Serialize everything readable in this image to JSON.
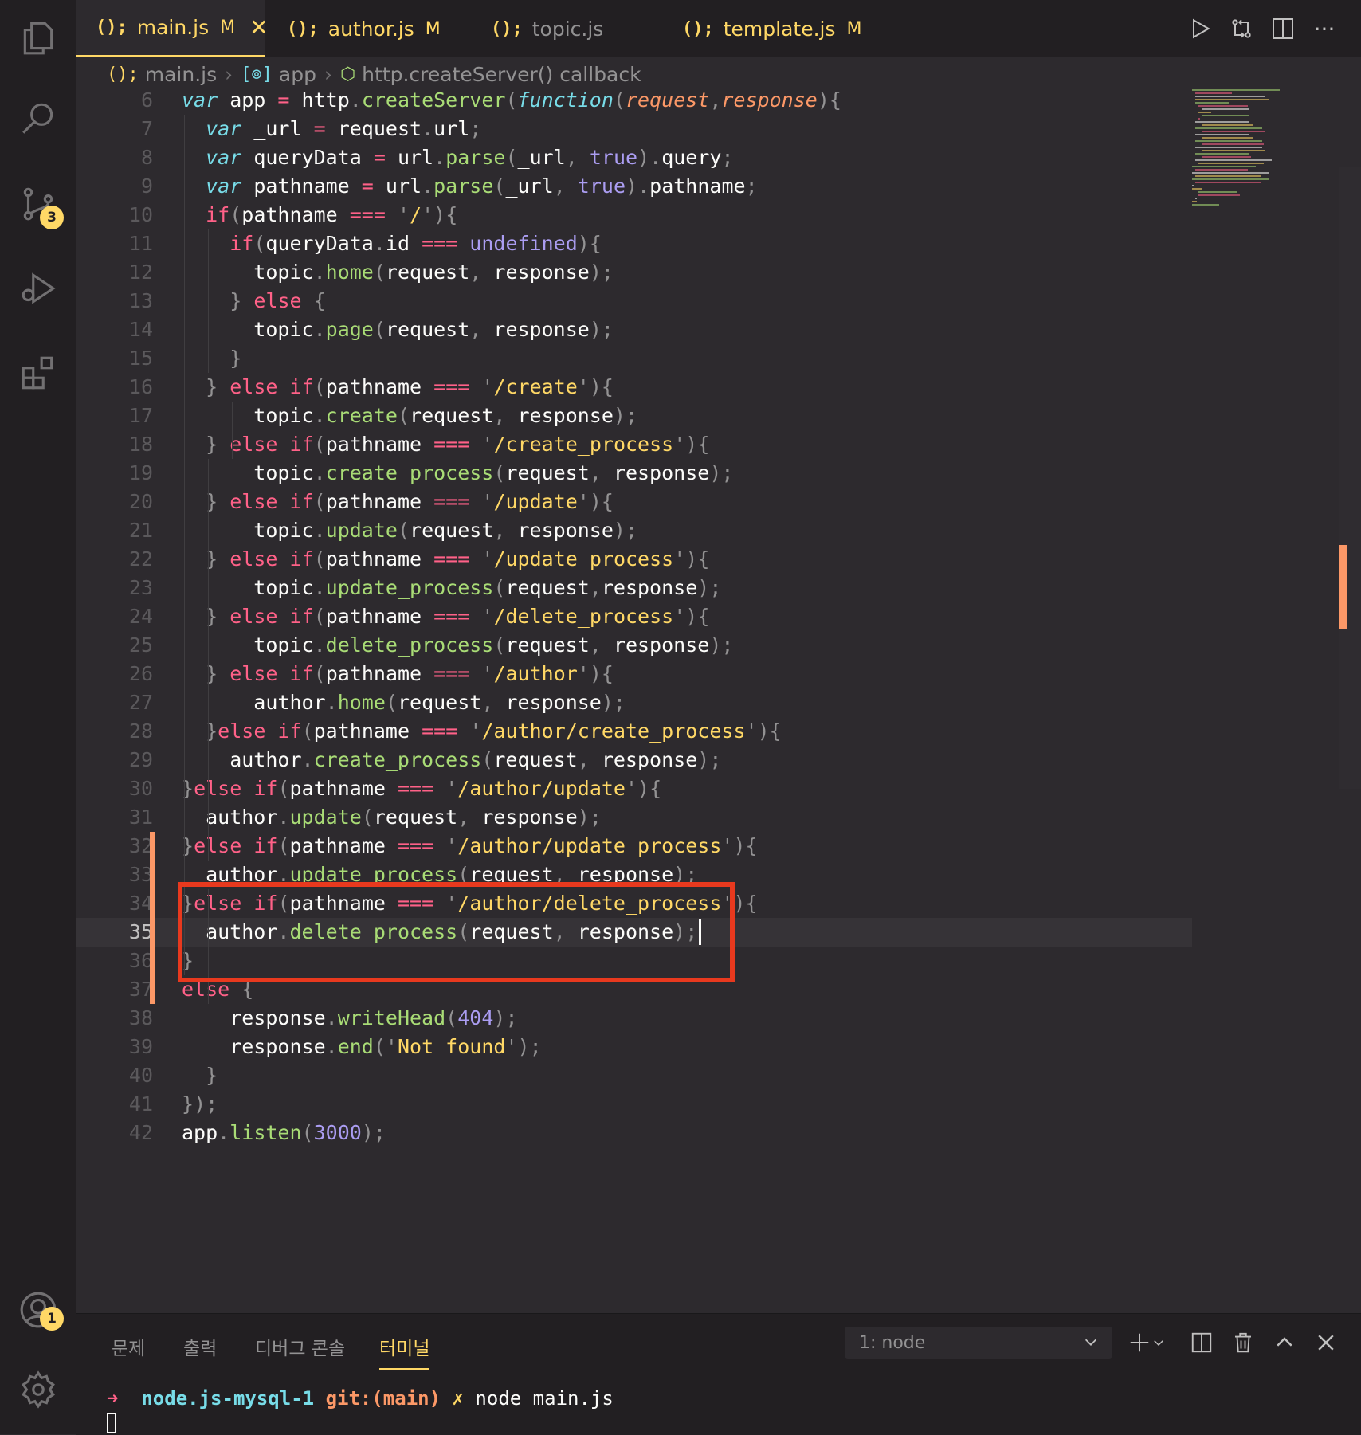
{
  "tabs": [
    {
      "icon": "(); ",
      "label": "main.js",
      "modified": "M",
      "active": true
    },
    {
      "icon": "(); ",
      "label": "author.js",
      "modified": "M",
      "active": false
    },
    {
      "icon": "(); ",
      "label": "topic.js",
      "modified": "",
      "active": false
    },
    {
      "icon": "(); ",
      "label": "template.js",
      "modified": "M",
      "active": false
    }
  ],
  "breadcrumb": {
    "file": "main.js",
    "symbol1": "app",
    "symbol2": "http.createServer() callback"
  },
  "badges": {
    "scm": "3",
    "accounts": "1"
  },
  "code": {
    "lines": [
      {
        "n": "6",
        "t": "var app = http.createServer(function(request,response){"
      },
      {
        "n": "7",
        "t": "  var _url = request.url;"
      },
      {
        "n": "8",
        "t": "  var queryData = url.parse(_url, true).query;"
      },
      {
        "n": "9",
        "t": "  var pathname = url.parse(_url, true).pathname;"
      },
      {
        "n": "10",
        "t": "  if(pathname === '/'){"
      },
      {
        "n": "11",
        "t": "    if(queryData.id === undefined){"
      },
      {
        "n": "12",
        "t": "      topic.home(request, response);"
      },
      {
        "n": "13",
        "t": "    } else {"
      },
      {
        "n": "14",
        "t": "      topic.page(request, response);"
      },
      {
        "n": "15",
        "t": "    }"
      },
      {
        "n": "16",
        "t": "  } else if(pathname === '/create'){"
      },
      {
        "n": "17",
        "t": "      topic.create(request, response);"
      },
      {
        "n": "18",
        "t": "  } else if(pathname === '/create_process'){"
      },
      {
        "n": "19",
        "t": "      topic.create_process(request, response);"
      },
      {
        "n": "20",
        "t": "  } else if(pathname === '/update'){"
      },
      {
        "n": "21",
        "t": "      topic.update(request, response);"
      },
      {
        "n": "22",
        "t": "  } else if(pathname === '/update_process'){"
      },
      {
        "n": "23",
        "t": "      topic.update_process(request,response);"
      },
      {
        "n": "24",
        "t": "  } else if(pathname === '/delete_process'){"
      },
      {
        "n": "25",
        "t": "      topic.delete_process(request, response);"
      },
      {
        "n": "26",
        "t": "  } else if(pathname === '/author'){"
      },
      {
        "n": "27",
        "t": "      author.home(request, response);"
      },
      {
        "n": "28",
        "t": "  }else if(pathname === '/author/create_process'){"
      },
      {
        "n": "29",
        "t": "    author.create_process(request, response);"
      },
      {
        "n": "30",
        "t": "}else if(pathname === '/author/update'){"
      },
      {
        "n": "31",
        "t": "  author.update(request, response);"
      },
      {
        "n": "32",
        "t": "}else if(pathname === '/author/update_process'){"
      },
      {
        "n": "33",
        "t": "  author.update_process(request, response);"
      },
      {
        "n": "34",
        "t": "}else if(pathname === '/author/delete_process'){"
      },
      {
        "n": "35",
        "t": "  author.delete_process(request, response);"
      },
      {
        "n": "36",
        "t": "}"
      },
      {
        "n": "37",
        "t": "else {"
      },
      {
        "n": "38",
        "t": "    response.writeHead(404);"
      },
      {
        "n": "39",
        "t": "    response.end('Not found');"
      },
      {
        "n": "40",
        "t": "  }"
      },
      {
        "n": "41",
        "t": "});"
      },
      {
        "n": "42",
        "t": "app.listen(3000);"
      }
    ],
    "current_line": "35"
  },
  "panel": {
    "tabs": [
      "문제",
      "출력",
      "디버그 콘솔",
      "터미널"
    ],
    "active_tab": "터미널",
    "terminal_select": "1: node",
    "prompt_arrow": "➜",
    "prompt_dir": "node.js-mysql-1",
    "prompt_git": "git:(main)",
    "prompt_dirty": "✗",
    "prompt_cmd": "node main.js"
  },
  "colors": {
    "accent": "#ffd866",
    "highlight_box": "#e8391e",
    "modified_gutter": "#fc9867"
  }
}
